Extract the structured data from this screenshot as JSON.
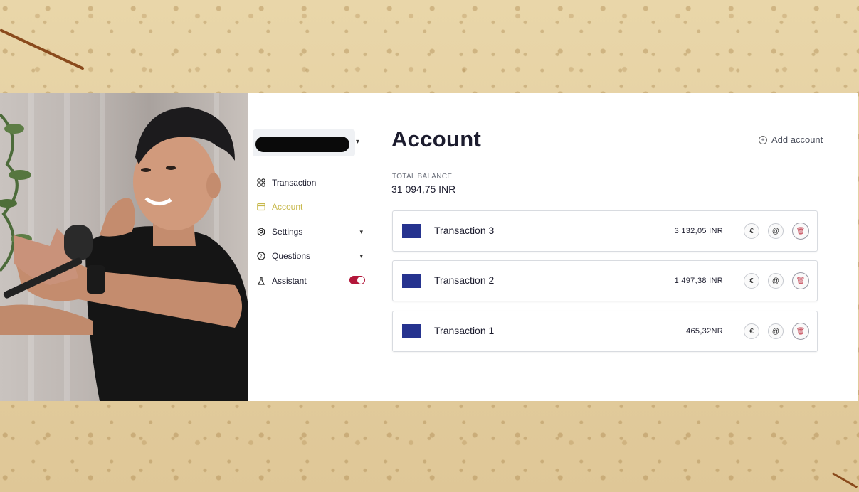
{
  "account_selector": {
    "value_redacted": true
  },
  "nav": [
    {
      "label": "Transaction",
      "icon": "grid-icon"
    },
    {
      "label": "Account",
      "icon": "card-icon",
      "active": true
    },
    {
      "label": "Settings",
      "icon": "gear-icon",
      "chevron": true
    },
    {
      "label": "Questions",
      "icon": "question-icon",
      "chevron": true
    },
    {
      "label": "Assistant",
      "icon": "flask-icon",
      "toggle_on": true
    }
  ],
  "page": {
    "title": "Account",
    "add_account_label": "Add account"
  },
  "balance": {
    "label": "TOTAL BALANCE",
    "value": "31 094,75 INR"
  },
  "transactions": [
    {
      "name": "Transaction 3",
      "amount": "3 132,05 INR"
    },
    {
      "name": "Transaction 2",
      "amount": "1 497,38 INR"
    },
    {
      "name": "Transaction 1",
      "amount": "465,32NR"
    }
  ],
  "colors": {
    "accent_active": "#c7b84a",
    "swatch": "#26338f",
    "toggle": "#b3163a"
  }
}
